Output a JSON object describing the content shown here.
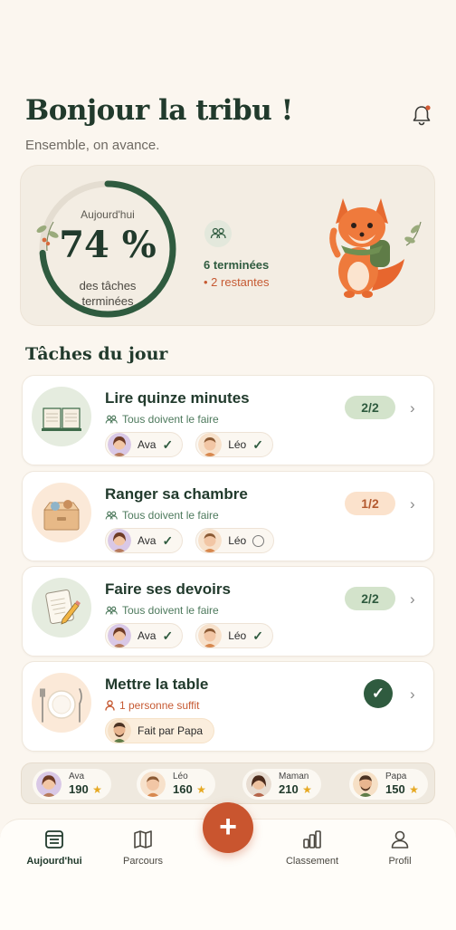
{
  "header": {
    "title": "Bonjour la tribu !",
    "subtitle": "Ensemble, on avance."
  },
  "summary": {
    "ring_label": "Aujourd'hui",
    "percent_text": "74 %",
    "progress": 0.74,
    "ring_sub": "des tâches terminées",
    "done": "6 terminées",
    "remaining": "• 2 restantes"
  },
  "section_title": "Tâches du jour",
  "tasks": [
    {
      "title": "Lire quinze minutes",
      "meta": "Tous doivent le faire",
      "badge": "2/2",
      "people": [
        {
          "name": "Ava",
          "status": "done"
        },
        {
          "name": "Léo",
          "status": "done"
        }
      ]
    },
    {
      "title": "Ranger sa chambre",
      "meta": "Tous doivent le faire",
      "badge": "1/2",
      "people": [
        {
          "name": "Ava",
          "status": "done"
        },
        {
          "name": "Léo",
          "status": "pending"
        }
      ]
    },
    {
      "title": "Faire ses devoirs",
      "meta": "Tous doivent le faire",
      "badge": "2/2",
      "people": [
        {
          "name": "Ava",
          "status": "done"
        },
        {
          "name": "Léo",
          "status": "done"
        }
      ]
    },
    {
      "title": "Mettre la table",
      "meta": "1 personne suffit",
      "done_by": "Fait par Papa"
    }
  ],
  "scores": [
    {
      "name": "Ava",
      "points": "190"
    },
    {
      "name": "Léo",
      "points": "160"
    },
    {
      "name": "Maman",
      "points": "210"
    },
    {
      "name": "Papa",
      "points": "150"
    }
  ],
  "nav": {
    "today": "Aujourd'hui",
    "journey": "Parcours",
    "add": "+",
    "ranking": "Classement",
    "profile": "Profil"
  },
  "colors": {
    "background": "#fbf6ef",
    "primary_green": "#2f5b3f",
    "accent_orange": "#c9552f"
  }
}
